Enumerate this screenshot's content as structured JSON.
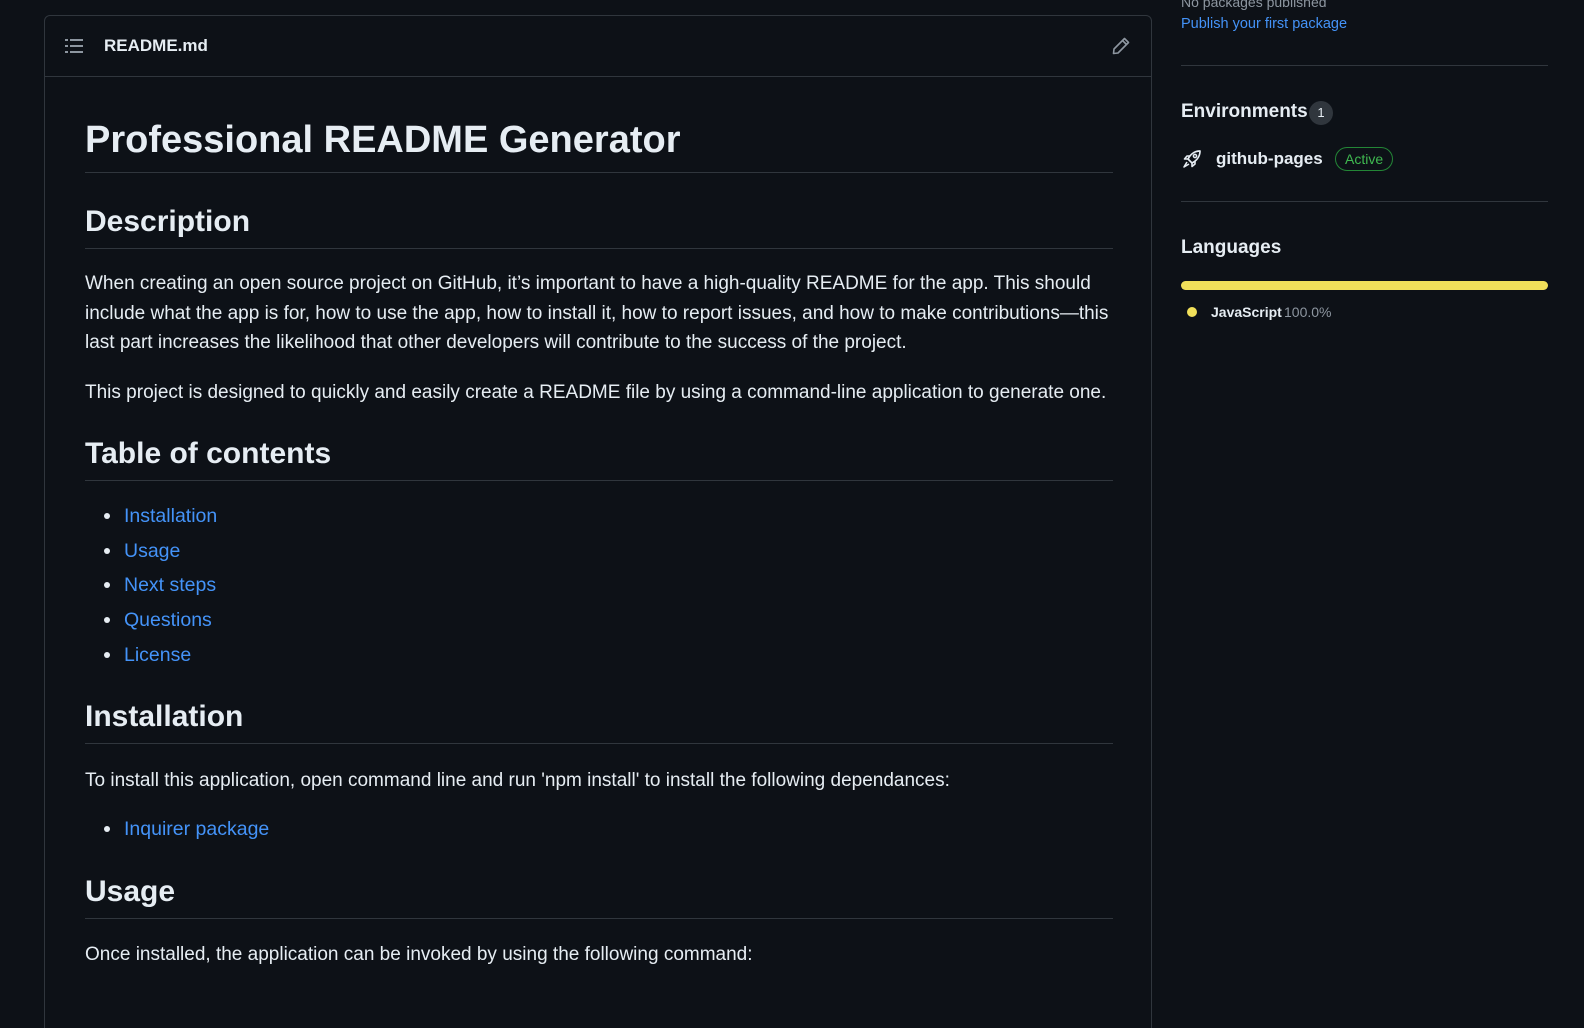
{
  "readme": {
    "filename": "README.md",
    "title": "Professional README Generator",
    "description_heading": "Description",
    "description_p1": "When creating an open source project on GitHub, it’s important to have a high-quality README for the app. This should include what the app is for, how to use the app, how to install it, how to report issues, and how to make contributions—this last part increases the likelihood that other developers will contribute to the success of the project.",
    "description_p2": "This project is designed to quickly and easily create a README file by using a command-line application to generate one.",
    "toc_heading": "Table of contents",
    "toc": [
      "Installation",
      "Usage",
      "Next steps",
      "Questions",
      "License"
    ],
    "installation_heading": "Installation",
    "installation_text": "To install this application, open command line and run 'npm install' to install the following dependances:",
    "installation_links": [
      "Inquirer package"
    ],
    "usage_heading": "Usage",
    "usage_text": "Once installed, the application can be invoked by using the following command:"
  },
  "sidebar": {
    "packages_status": "No packages published",
    "publish_link": "Publish your first package",
    "environments_heading": "Environments",
    "environments_count": "1",
    "environment_name": "github-pages",
    "environment_status": "Active",
    "languages_heading": "Languages",
    "languages": [
      {
        "name": "JavaScript",
        "percent": "100.0%",
        "fraction": 1.0,
        "color": "#f1e05a"
      }
    ]
  },
  "colors": {
    "background": "#0d1117",
    "border": "#30363d",
    "text": "#e6edf3",
    "muted": "#8d96a0",
    "link": "#4493f8",
    "active_green": "#3fb950"
  },
  "icons": {
    "toc": "list-unordered-icon",
    "edit": "pencil-icon",
    "environment": "rocket-icon"
  }
}
